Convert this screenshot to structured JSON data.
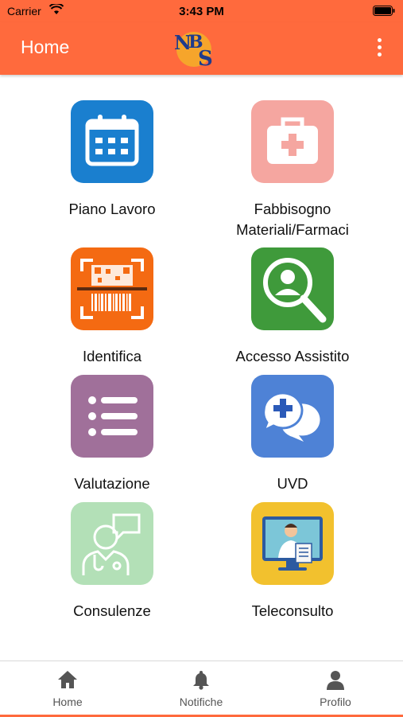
{
  "status_bar": {
    "carrier": "Carrier",
    "time": "3:43 PM"
  },
  "app_bar": {
    "title": "Home",
    "logo_text": "NBS"
  },
  "tiles": [
    {
      "label": "Piano Lavoro",
      "color": "#1a7fcf"
    },
    {
      "label": "Fabbisogno Materiali/Farmaci",
      "color": "#f5a6a0"
    },
    {
      "label": "Identifica",
      "color": "#f46a12"
    },
    {
      "label": "Accesso Assistito",
      "color": "#3f9a3b"
    },
    {
      "label": "Valutazione",
      "color": "#a0709a"
    },
    {
      "label": "UVD",
      "color": "#4e82d6"
    },
    {
      "label": "Consulenze",
      "color": "#b3e0b7"
    },
    {
      "label": "Teleconsulto",
      "color": "#f2c12e"
    }
  ],
  "bottom_nav": {
    "items": [
      {
        "label": "Home",
        "icon": "home-icon"
      },
      {
        "label": "Notifiche",
        "icon": "bell-icon"
      },
      {
        "label": "Profilo",
        "icon": "user-icon"
      }
    ]
  },
  "theme": {
    "accent": "#ff6a3d"
  }
}
